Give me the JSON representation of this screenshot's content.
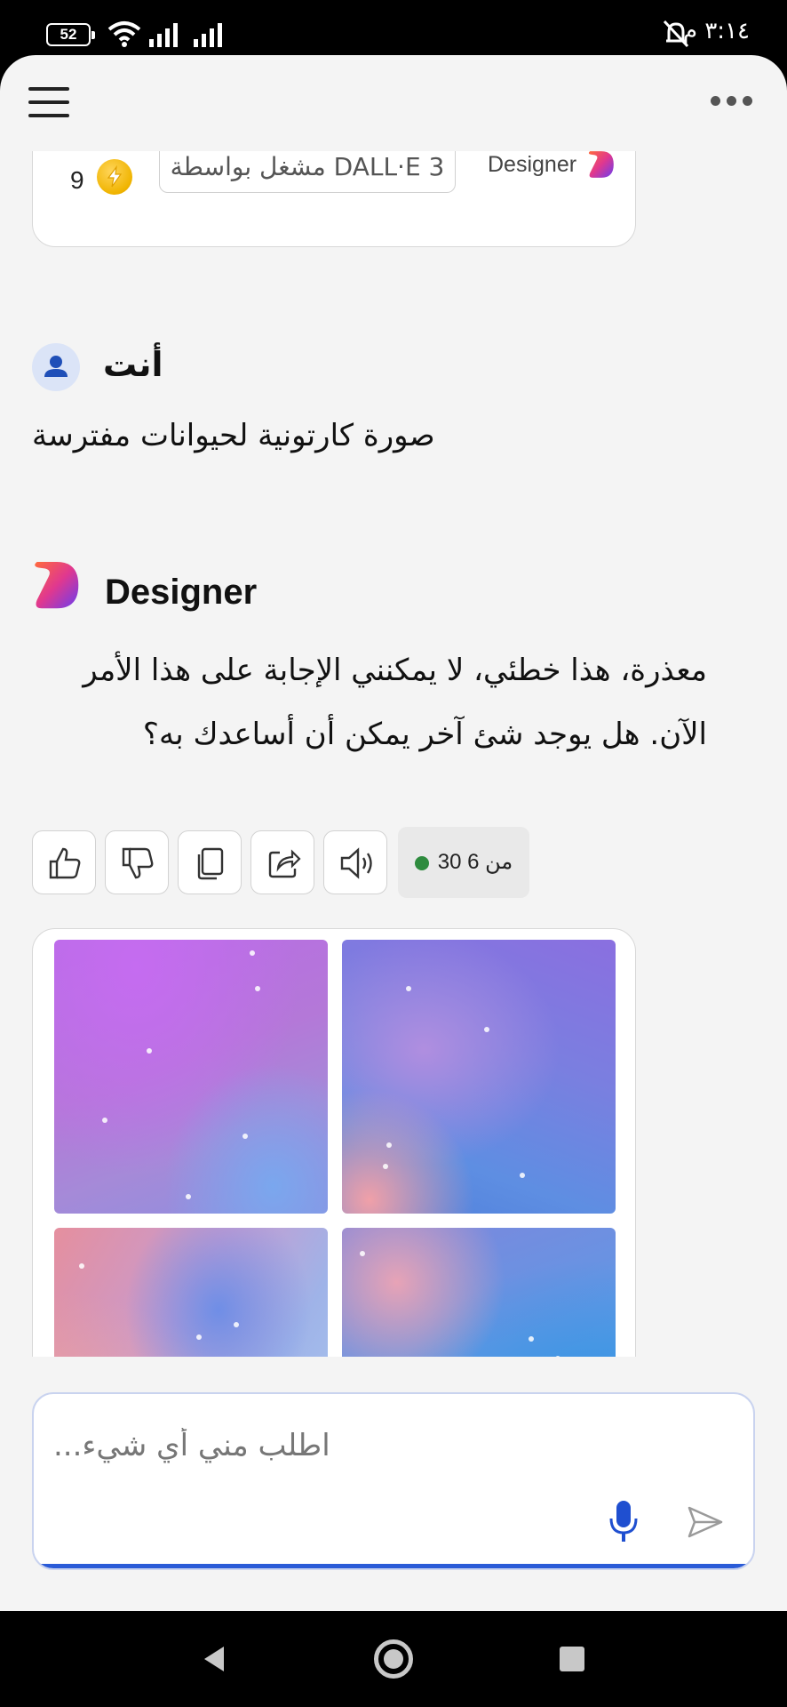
{
  "status_bar": {
    "battery": "52",
    "time": "٣:١٤ م"
  },
  "header": {
    "menu_icon": "hamburger-menu-icon",
    "more_icon": "more-options-icon"
  },
  "previous_card": {
    "credits": "9",
    "powered_by": "مشغل بواسطة DALL·E 3",
    "brand": "Designer"
  },
  "user_message": {
    "author": "أنت",
    "text": "صورة كارتونية لحيوانات مفترسة"
  },
  "bot_message": {
    "author": "Designer",
    "text": "معذرة، هذا خطئي، لا يمكنني الإجابة على هذا الأمر الآن. هل يوجد شئ آخر يمكن أن أساعدك به؟",
    "turns": "30 من 6",
    "actions": [
      "thumbs-up-icon",
      "thumbs-down-icon",
      "copy-icon",
      "share-icon",
      "speaker-icon"
    ]
  },
  "composer": {
    "placeholder": "اطلب مني أي شيء..."
  },
  "colors": {
    "accent": "#2a5bd7",
    "status_dot": "#2e8b3e",
    "coin": "#f0b400"
  }
}
